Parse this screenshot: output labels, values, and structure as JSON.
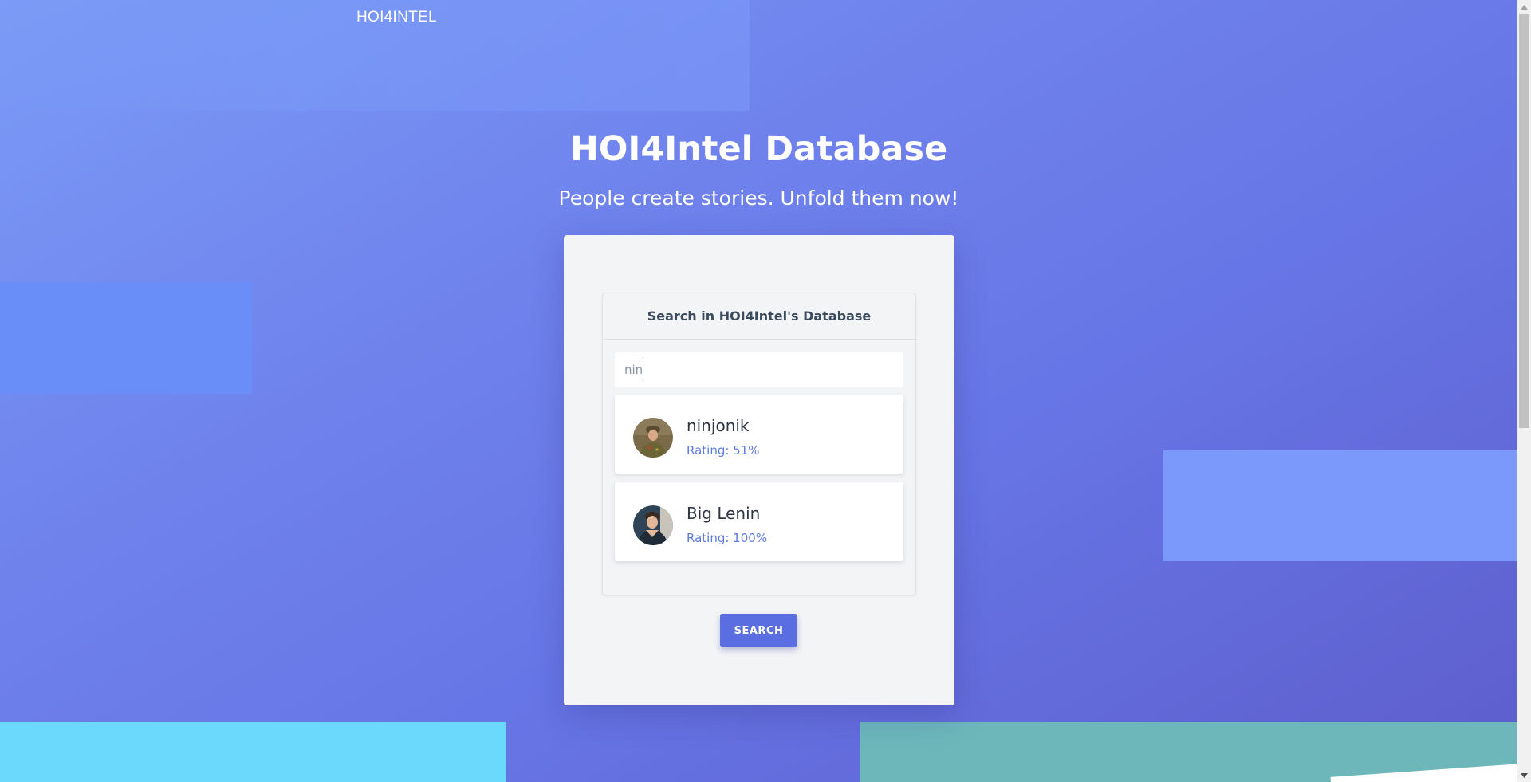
{
  "nav": {
    "brand": "HOI4INTEL"
  },
  "hero": {
    "title": "HOI4Intel Database",
    "subtitle": "People create stories. Unfold them now!"
  },
  "search": {
    "panel_title": "Search in HOI4Intel's Database",
    "input_value": "nin",
    "button_label": "SEARCH",
    "results": [
      {
        "name": "ninjonik",
        "rating": "Rating: 51%"
      },
      {
        "name": "Big Lenin",
        "rating": "Rating: 100%"
      }
    ]
  },
  "colors": {
    "accent": "#5b6ee1",
    "rating_text": "#5f7ae0",
    "panel_bg": "#f3f4f6"
  }
}
